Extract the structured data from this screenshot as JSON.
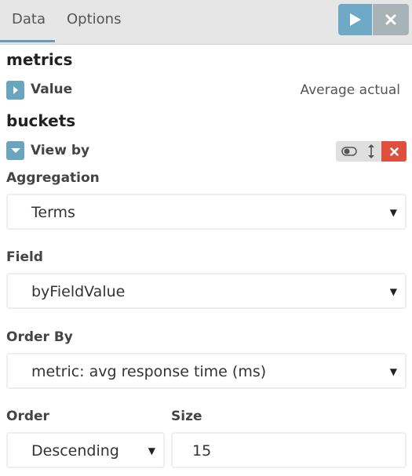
{
  "tabs": {
    "data_label": "Data",
    "options_label": "Options"
  },
  "toolbar": {
    "run_icon": "play-icon",
    "close_icon": "close-icon"
  },
  "metrics": {
    "title": "metrics",
    "agg_label": "Value",
    "agg_description": "Average actual"
  },
  "buckets": {
    "title": "buckets",
    "agg_label": "View by"
  },
  "form": {
    "aggregation": {
      "label": "Aggregation",
      "value": "Terms"
    },
    "field": {
      "label": "Field",
      "value": "byFieldValue"
    },
    "order_by": {
      "label": "Order By",
      "value": "metric: avg response time (ms)"
    },
    "order": {
      "label": "Order",
      "value": "Descending"
    },
    "size": {
      "label": "Size",
      "value": "15"
    }
  },
  "colors": {
    "accent": "#6eaac5",
    "danger": "#e04e3e",
    "header_bg": "#e6e6e6"
  }
}
